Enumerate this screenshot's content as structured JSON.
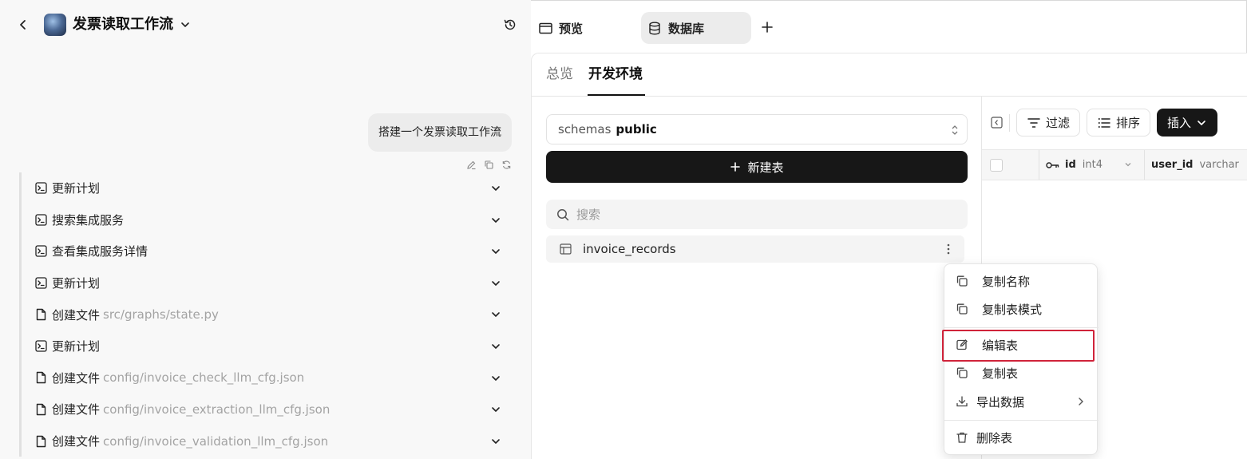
{
  "header": {
    "app_title": "发票读取工作流"
  },
  "chat": {
    "user_message": "搭建一个发票读取工作流",
    "steps": [
      {
        "label": "更新计划",
        "path": "",
        "icon": "terminal-icon"
      },
      {
        "label": "搜索集成服务",
        "path": "",
        "icon": "terminal-icon"
      },
      {
        "label": "查看集成服务详情",
        "path": "",
        "icon": "terminal-icon"
      },
      {
        "label": "更新计划",
        "path": "",
        "icon": "terminal-icon"
      },
      {
        "label": "创建文件",
        "path": "src/graphs/state.py",
        "icon": "file-icon"
      },
      {
        "label": "更新计划",
        "path": "",
        "icon": "terminal-icon"
      },
      {
        "label": "创建文件",
        "path": "config/invoice_check_llm_cfg.json",
        "icon": "file-icon"
      },
      {
        "label": "创建文件",
        "path": "config/invoice_extraction_llm_cfg.json",
        "icon": "file-icon"
      },
      {
        "label": "创建文件",
        "path": "config/invoice_validation_llm_cfg.json",
        "icon": "file-icon"
      }
    ]
  },
  "top_tabs": {
    "preview": "预览",
    "database": "数据库"
  },
  "sub_tabs": {
    "overview": "总览",
    "dev_env": "开发环境"
  },
  "schema": {
    "label": "schemas",
    "value": "public"
  },
  "new_table_label": "新建表",
  "search": {
    "placeholder": "搜索"
  },
  "tables": [
    {
      "name": "invoice_records"
    }
  ],
  "toolbar": {
    "filter": "过滤",
    "sort": "排序",
    "insert": "插入"
  },
  "grid": {
    "columns": [
      {
        "name": "id",
        "type": "int4"
      },
      {
        "name": "user_id",
        "type": "varchar"
      }
    ]
  },
  "context_menu": {
    "copy_name": "复制名称",
    "copy_schema": "复制表模式",
    "edit_table": "编辑表",
    "duplicate_table": "复制表",
    "export_data": "导出数据",
    "delete_table": "删除表"
  },
  "colors": {
    "accent_dark": "#171717",
    "highlight_red": "#d0233a"
  }
}
